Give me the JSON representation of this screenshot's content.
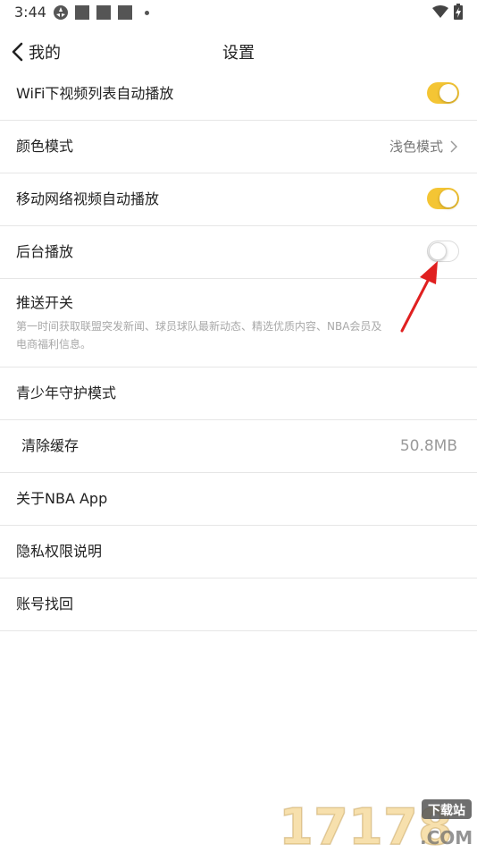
{
  "status_bar": {
    "time": "3:44",
    "icons": [
      "app-logo-icon",
      "notification-square-icon",
      "notification-square-icon",
      "notification-square-icon",
      "more-dot-icon",
      "wifi-icon",
      "battery-charging-icon"
    ]
  },
  "header": {
    "back_label": "我的",
    "title": "设置"
  },
  "settings": {
    "wifi_autoplay": {
      "label": "WiFi下视频列表自动播放",
      "enabled": true
    },
    "color_mode": {
      "label": "颜色模式",
      "value": "浅色模式"
    },
    "mobile_autoplay": {
      "label": "移动网络视频自动播放",
      "enabled": true
    },
    "background_play": {
      "label": "后台播放",
      "enabled": false
    },
    "push": {
      "label": "推送开关",
      "desc_line1": "第一时间获取联盟突发新闻、球员球队最新动态、精选优质内容、NBA会员及",
      "desc_line2": "电商福利信息。"
    },
    "youth_mode": {
      "label": "青少年守护模式"
    },
    "clear_cache": {
      "label": "清除缓存",
      "value": "50.8MB"
    },
    "about": {
      "label": "关于NBA App"
    },
    "privacy": {
      "label": "隐私权限说明"
    },
    "account_recovery": {
      "label": "账号找回"
    }
  },
  "watermark": {
    "number": "17178",
    "tag": "下载站",
    "domain": ".COM"
  },
  "colors": {
    "toggle_on": "#f4c534",
    "annotation_arrow": "#e02020"
  }
}
